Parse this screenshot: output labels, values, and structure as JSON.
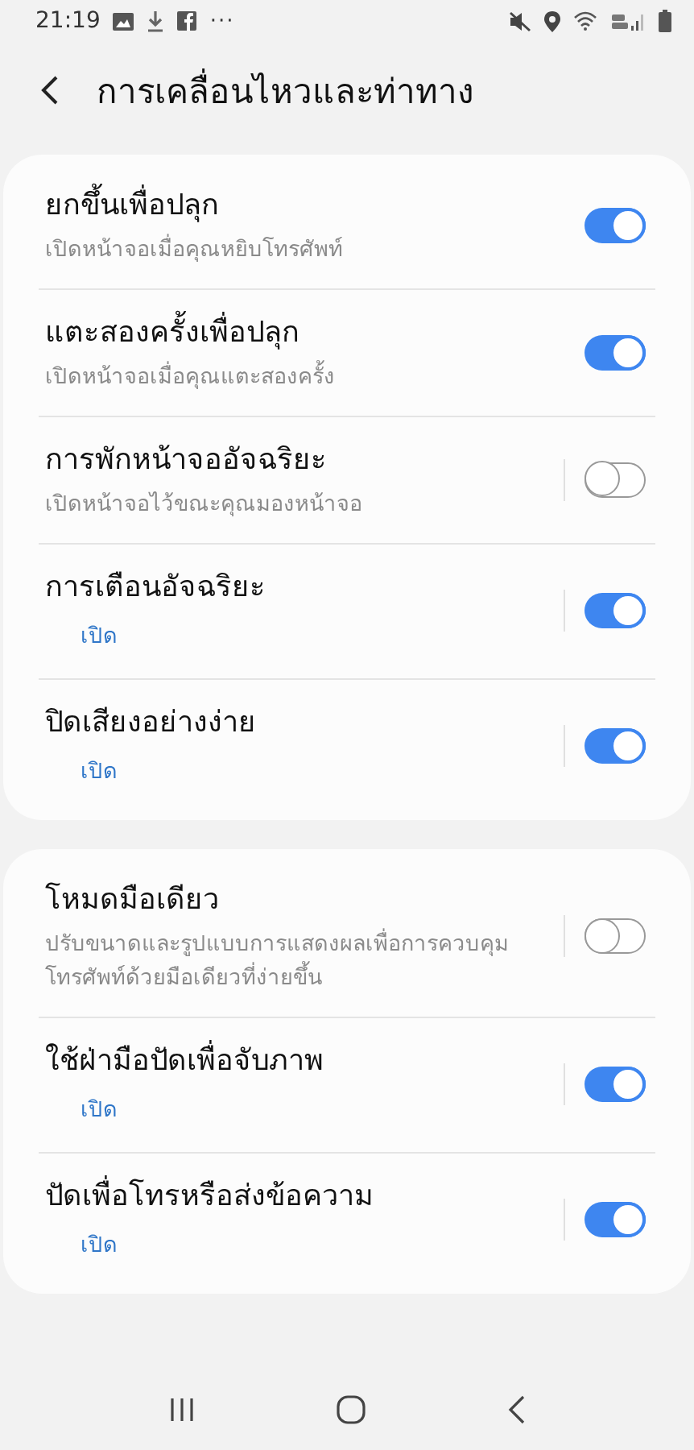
{
  "status_bar": {
    "time": "21:19",
    "more": "···"
  },
  "header": {
    "title": "การเคลื่อนไหวและท่าทาง"
  },
  "groups": [
    {
      "items": [
        {
          "title": "ยกขึ้นเพื่อปลุก",
          "subtitle": "เปิดหน้าจอเมื่อคุณหยิบโทรศัพท์",
          "kind": "description",
          "has_submenu": false,
          "on": true
        },
        {
          "title": "แตะสองครั้งเพื่อปลุก",
          "subtitle": "เปิดหน้าจอเมื่อคุณแตะสองครั้ง",
          "kind": "description",
          "has_submenu": false,
          "on": true
        },
        {
          "title": "การพักหน้าจออัจฉริยะ",
          "subtitle": "เปิดหน้าจอไว้ขณะคุณมองหน้าจอ",
          "kind": "description",
          "has_submenu": true,
          "on": false
        },
        {
          "title": "การเตือนอัจฉริยะ",
          "subtitle": "เปิด",
          "kind": "status",
          "has_submenu": true,
          "on": true
        },
        {
          "title": "ปิดเสียงอย่างง่าย",
          "subtitle": "เปิด",
          "kind": "status",
          "has_submenu": true,
          "on": true
        }
      ]
    },
    {
      "items": [
        {
          "title": "โหมดมือเดียว",
          "subtitle": "ปรับขนาดและรูปแบบการแสดงผลเพื่อการควบคุมโทรศัพท์ด้วยมือเดียวที่ง่ายขึ้น",
          "kind": "description",
          "has_submenu": true,
          "on": false
        },
        {
          "title": "ใช้ฝ่ามือปัดเพื่อจับภาพ",
          "subtitle": "เปิด",
          "kind": "status",
          "has_submenu": true,
          "on": true
        },
        {
          "title": "ปัดเพื่อโทรหรือส่งข้อความ",
          "subtitle": "เปิด",
          "kind": "status",
          "has_submenu": true,
          "on": true
        }
      ]
    }
  ]
}
